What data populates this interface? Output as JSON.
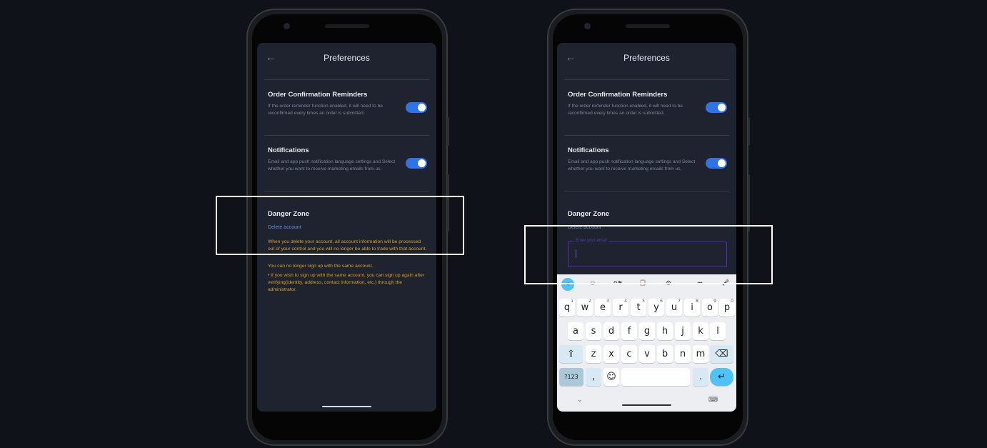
{
  "screens": [
    {
      "title": "Preferences",
      "back_icon": "←",
      "sections": [
        {
          "title": "Order Confirmation Reminders",
          "desc": "If the order reminder function enabled, it will need to be reconfirmed every times an order is submitted.",
          "toggle": true
        },
        {
          "title": "Notifications",
          "desc": "Email and app push notification language settings and Select whether you want to receive marketing emails from us.",
          "toggle": true
        }
      ],
      "danger": {
        "title": "Danger Zone",
        "link": "Delete account",
        "warn1": "When you delete your account, all account information will be processed out of your control and you will no longer be able to trade with that account.",
        "warn2": "You can no longer sign up with the same account.",
        "warn3": "• If you wish to sign up with the same account, you can sign up again after verifying(identity, address, contact information, etc.) through  the administrator."
      }
    },
    {
      "title": "Preferences",
      "back_icon": "←",
      "sections": [
        {
          "title": "Order Confirmation Reminders",
          "desc": "If the order reminder function enabled, it will need to be reconfirmed every times an order is submitted.",
          "toggle": true
        },
        {
          "title": "Notifications",
          "desc": "Email and app push notification language settings and Select whether you want to receive marketing emails from us.",
          "toggle": true
        }
      ],
      "danger": {
        "title": "Danger Zone",
        "link": "Delete account",
        "email_placeholder": "Enter your email"
      },
      "keyboard": {
        "toolbar": [
          "‹",
          "☺",
          "GIF",
          "📋",
          "⚙",
          "•••",
          "🎤"
        ],
        "row1": [
          "q",
          "w",
          "e",
          "r",
          "t",
          "y",
          "u",
          "i",
          "o",
          "p"
        ],
        "row1_hints": [
          "1",
          "2",
          "3",
          "4",
          "5",
          "6",
          "7",
          "8",
          "9",
          "0"
        ],
        "row2": [
          "a",
          "s",
          "d",
          "f",
          "g",
          "h",
          "j",
          "k",
          "l"
        ],
        "row3": [
          "z",
          "x",
          "c",
          "v",
          "b",
          "n",
          "m"
        ],
        "shift": "⇧",
        "backspace": "⌫",
        "symbols": "?123",
        "comma": ",",
        "emoji": "☺",
        "period": ".",
        "enter": "↵",
        "hide": "⌄",
        "switch": "⌨"
      }
    }
  ],
  "colors": {
    "accent": "#2f73e8",
    "warning": "#d4a21c",
    "link": "#5c8fe0",
    "focus": "#4d2ebf"
  }
}
